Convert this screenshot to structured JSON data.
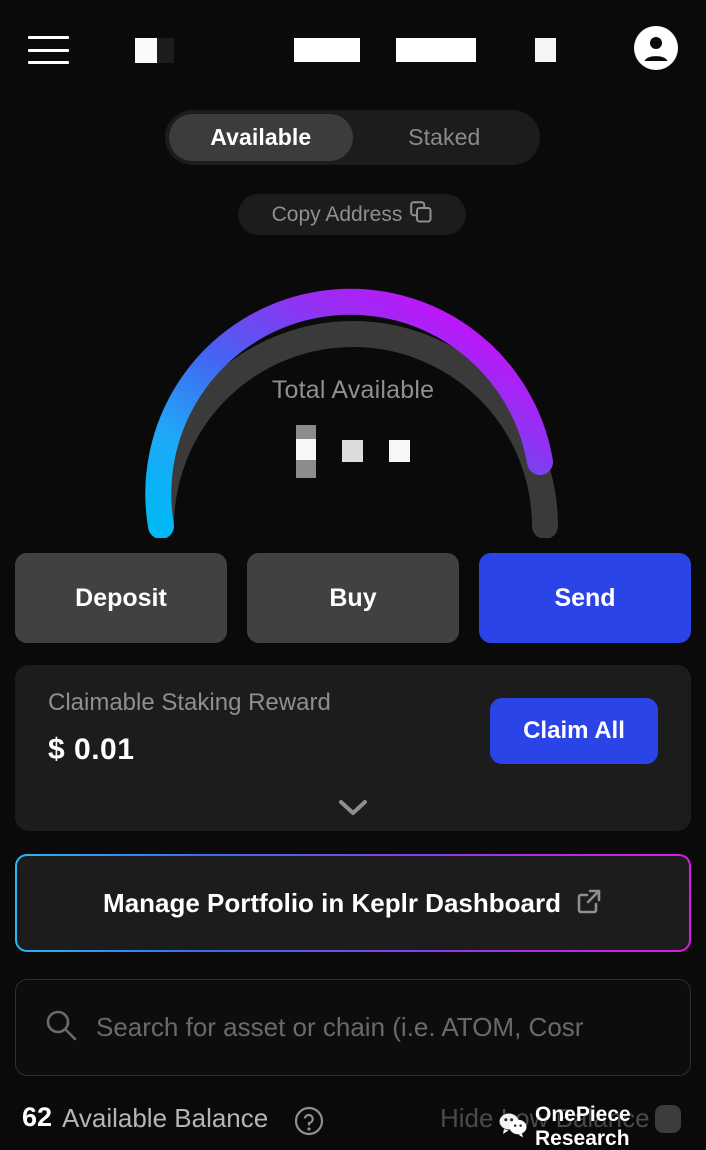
{
  "header": {
    "menu_icon": "hamburger-menu-icon",
    "avatar_icon": "profile-avatar-icon",
    "masked_items": [
      "chain-badge-masked",
      "chain-name-masked",
      "address-masked",
      "network-icon-masked"
    ]
  },
  "tabs": {
    "items": [
      {
        "label": "Available",
        "active": true
      },
      {
        "label": "Staked",
        "active": false
      }
    ]
  },
  "copy_address": {
    "label": "Copy Address",
    "icon": "copy-icon"
  },
  "gauge": {
    "label": "Total Available",
    "amount_masked": true,
    "gradient_start": "#00B9F5",
    "gradient_mid": "#4464F2",
    "gradient_end": "#E100FF",
    "track_color": "#3A3A3A",
    "progress_percent": 92
  },
  "actions": [
    {
      "label": "Deposit",
      "style": "secondary"
    },
    {
      "label": "Buy",
      "style": "secondary"
    },
    {
      "label": "Send",
      "style": "primary"
    }
  ],
  "reward": {
    "title": "Claimable Staking Reward",
    "amount": "$ 0.01",
    "claim_label": "Claim All",
    "expand_icon": "chevron-down-icon"
  },
  "dashboard": {
    "label": "Manage Portfolio in Keplr Dashboard",
    "icon": "external-link-icon"
  },
  "search": {
    "placeholder": "Search for asset or chain (i.e. ATOM, Cosr",
    "value": "",
    "icon": "search-icon"
  },
  "bottom": {
    "count": "62",
    "balance_label": "Available Balance",
    "help_icon": "help-circle-icon",
    "hide_low_label": "Hide Low Balance",
    "toggle_on": false
  },
  "watermark": {
    "text": "OnePiece Research",
    "icon": "wechat-icon"
  },
  "colors": {
    "background": "#0A0A0A",
    "card": "#1C1C1C",
    "primary_blue": "#2A44E8",
    "secondary_gray": "#414141",
    "muted_text": "#8E8E93"
  }
}
